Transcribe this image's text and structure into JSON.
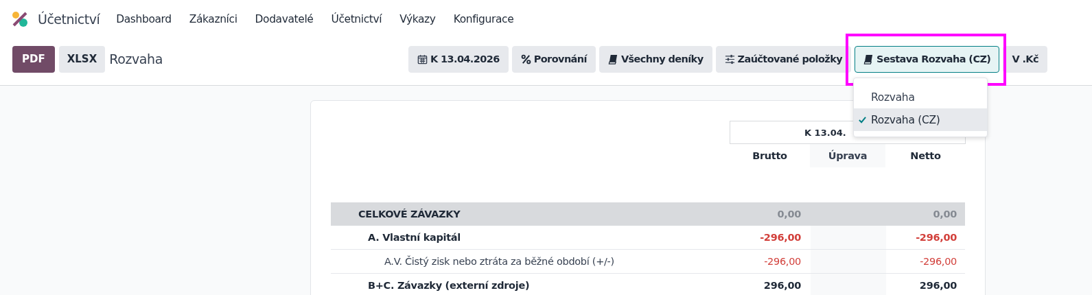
{
  "app": {
    "title": "Účetnictví"
  },
  "nav": [
    "Dashboard",
    "Zákazníci",
    "Dodavatelé",
    "Účetnictví",
    "Výkazy",
    "Konfigurace"
  ],
  "toolbar": {
    "export_buttons": [
      {
        "label": "PDF",
        "primary": true
      },
      {
        "label": "XLSX",
        "primary": false
      }
    ],
    "report_title": "Rozvaha",
    "filters": [
      {
        "label": "K 13.04.2026",
        "active": false
      },
      {
        "label": "Porovnání",
        "active": false
      },
      {
        "label": "Všechny deníky",
        "active": false
      },
      {
        "label": "Zaúčtované položky",
        "active": false
      },
      {
        "label": "Sestava Rozvaha (CZ)",
        "active": true
      },
      {
        "label": "V .Kč",
        "active": false
      }
    ]
  },
  "dropdown": {
    "items": [
      {
        "label": "Rozvaha",
        "selected": false
      },
      {
        "label": "Rozvaha (CZ)",
        "selected": true
      }
    ]
  },
  "report": {
    "period": "K 13.04.",
    "columns": [
      "Brutto",
      "Úprava",
      "Netto"
    ],
    "rows": [
      {
        "kind": "total",
        "name": "CELKOVÉ ZÁVAZKY",
        "values": [
          {
            "text": "0,00",
            "negative": false,
            "muted": true
          },
          {
            "text": "0,00",
            "negative": false,
            "muted": true
          }
        ],
        "children": [
          {
            "kind": "section",
            "name": "A. Vlastní kapitál",
            "values": [
              {
                "text": "-296,00",
                "negative": true,
                "muted": false
              },
              {
                "text": "-296,00",
                "negative": true,
                "muted": false
              }
            ],
            "children": [
              {
                "kind": "line",
                "name": "A.V. Čistý zisk nebo ztráta za běžné období (+/-)",
                "values": [
                  {
                    "text": "-296,00",
                    "negative": true,
                    "muted": false
                  },
                  {
                    "text": "-296,00",
                    "negative": true,
                    "muted": false
                  }
                ]
              }
            ]
          },
          {
            "kind": "section",
            "name": "B+C. Závazky (externí zdroje)",
            "values": [
              {
                "text": "296,00",
                "negative": false,
                "muted": false
              },
              {
                "text": "296,00",
                "negative": false,
                "muted": false
              }
            ]
          }
        ]
      }
    ]
  }
}
